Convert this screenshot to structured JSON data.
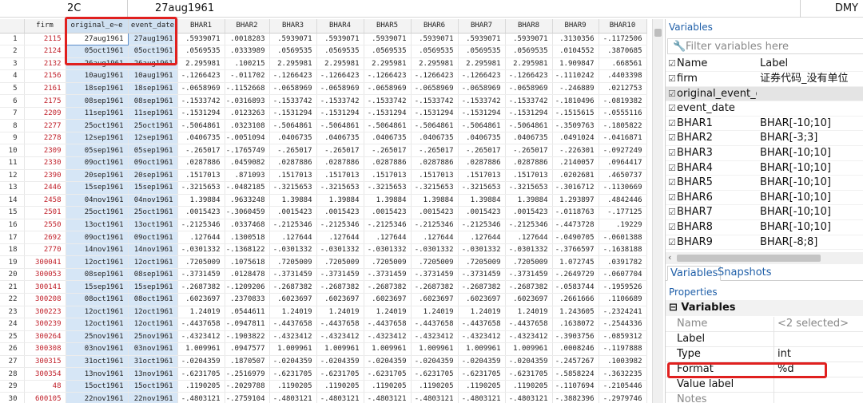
{
  "topbar": {
    "cell_ref": "2C",
    "cell_value": "27aug1961",
    "format_hint": "DMY"
  },
  "grid": {
    "columns": [
      "firm",
      "original_e~e",
      "event_date",
      "BHAR1",
      "BHAR2",
      "BHAR3",
      "BHAR4",
      "BHAR5",
      "BHAR6",
      "BHAR7",
      "BHAR8",
      "BHAR9",
      "BHAR10"
    ],
    "rows": [
      [
        "1",
        "2115",
        "27aug1961",
        "27aug1961",
        ".5939071",
        ".0018283",
        ".5939071",
        ".5939071",
        ".5939071",
        ".5939071",
        ".5939071",
        ".5939071",
        ".3130356",
        "-.1172506"
      ],
      [
        "2",
        "2124",
        "05oct1961",
        "05oct1961",
        ".0569535",
        ".0333989",
        ".0569535",
        ".0569535",
        ".0569535",
        ".0569535",
        ".0569535",
        ".0569535",
        ".0104552",
        ".3870685"
      ],
      [
        "3",
        "2132",
        "26aug1961",
        "26aug1961",
        "2.295981",
        ".100215",
        "2.295981",
        "2.295981",
        "2.295981",
        "2.295981",
        "2.295981",
        "2.295981",
        "1.909847",
        ".668561"
      ],
      [
        "4",
        "2156",
        "10aug1961",
        "10aug1961",
        "-.1266423",
        "-.011702",
        "-.1266423",
        "-.1266423",
        "-.1266423",
        "-.1266423",
        "-.1266423",
        "-.1266423",
        "-.1110242",
        ".4403398"
      ],
      [
        "5",
        "2161",
        "18sep1961",
        "18sep1961",
        "-.0658969",
        "-.1152668",
        "-.0658969",
        "-.0658969",
        "-.0658969",
        "-.0658969",
        "-.0658969",
        "-.0658969",
        "-.246889",
        ".0212753"
      ],
      [
        "6",
        "2175",
        "08sep1961",
        "08sep1961",
        "-.1533742",
        "-.0316893",
        "-.1533742",
        "-.1533742",
        "-.1533742",
        "-.1533742",
        "-.1533742",
        "-.1533742",
        "-.1810496",
        "-.0819382"
      ],
      [
        "7",
        "2209",
        "11sep1961",
        "11sep1961",
        "-.1531294",
        ".0123263",
        "-.1531294",
        "-.1531294",
        "-.1531294",
        "-.1531294",
        "-.1531294",
        "-.1531294",
        "-.1515615",
        "-.0555116"
      ],
      [
        "8",
        "2277",
        "25oct1961",
        "25oct1961",
        "-.5064861",
        ".0323108",
        "-.5064861",
        "-.5064861",
        "-.5064861",
        "-.5064861",
        "-.5064861",
        "-.5064861",
        "-.3509763",
        "-.1805822"
      ],
      [
        "9",
        "2278",
        "12sep1961",
        "12sep1961",
        ".0406735",
        "-.0051094",
        ".0406735",
        ".0406735",
        ".0406735",
        ".0406735",
        ".0406735",
        ".0406735",
        ".0491024",
        "-.0416871"
      ],
      [
        "10",
        "2309",
        "05sep1961",
        "05sep1961",
        "-.265017",
        "-.1765749",
        "-.265017",
        "-.265017",
        "-.265017",
        "-.265017",
        "-.265017",
        "-.265017",
        "-.226301",
        "-.0927249"
      ],
      [
        "11",
        "2330",
        "09oct1961",
        "09oct1961",
        ".0287886",
        ".0459082",
        ".0287886",
        ".0287886",
        ".0287886",
        ".0287886",
        ".0287886",
        ".0287886",
        ".2140057",
        ".0964417"
      ],
      [
        "12",
        "2390",
        "20sep1961",
        "20sep1961",
        ".1517013",
        ".871093",
        ".1517013",
        ".1517013",
        ".1517013",
        ".1517013",
        ".1517013",
        ".1517013",
        ".0202681",
        ".4650737"
      ],
      [
        "13",
        "2446",
        "15sep1961",
        "15sep1961",
        "-.3215653",
        "-.0482185",
        "-.3215653",
        "-.3215653",
        "-.3215653",
        "-.3215653",
        "-.3215653",
        "-.3215653",
        "-.3016712",
        "-.1130669"
      ],
      [
        "14",
        "2458",
        "04nov1961",
        "04nov1961",
        "1.39884",
        ".9633248",
        "1.39884",
        "1.39884",
        "1.39884",
        "1.39884",
        "1.39884",
        "1.39884",
        "1.293897",
        ".4842446"
      ],
      [
        "15",
        "2501",
        "25oct1961",
        "25oct1961",
        ".0015423",
        "-.3060459",
        ".0015423",
        ".0015423",
        ".0015423",
        ".0015423",
        ".0015423",
        ".0015423",
        "-.0118763",
        "-.177125"
      ],
      [
        "16",
        "2550",
        "13oct1961",
        "13oct1961",
        "-.2125346",
        ".0337468",
        "-.2125346",
        "-.2125346",
        "-.2125346",
        "-.2125346",
        "-.2125346",
        "-.2125346",
        "-.4473728",
        ".19229"
      ],
      [
        "17",
        "2692",
        "09oct1961",
        "09oct1961",
        ".127644",
        ".1300518",
        ".127644",
        ".127644",
        ".127644",
        ".127644",
        ".127644",
        ".127644",
        "-.0490705",
        "-.0601388"
      ],
      [
        "18",
        "2770",
        "14nov1961",
        "14nov1961",
        "-.0301332",
        "-.1368122",
        "-.0301332",
        "-.0301332",
        "-.0301332",
        "-.0301332",
        "-.0301332",
        "-.0301332",
        "-.3766597",
        "-.1638188"
      ],
      [
        "19",
        "300041",
        "12oct1961",
        "12oct1961",
        ".7205009",
        ".1075618",
        ".7205009",
        ".7205009",
        ".7205009",
        ".7205009",
        ".7205009",
        ".7205009",
        "1.072745",
        ".0391782"
      ],
      [
        "20",
        "300053",
        "08sep1961",
        "08sep1961",
        "-.3731459",
        ".0128478",
        "-.3731459",
        "-.3731459",
        "-.3731459",
        "-.3731459",
        "-.3731459",
        "-.3731459",
        "-.2649729",
        "-.0607704"
      ],
      [
        "21",
        "300141",
        "15sep1961",
        "15sep1961",
        "-.2687382",
        "-.1209206",
        "-.2687382",
        "-.2687382",
        "-.2687382",
        "-.2687382",
        "-.2687382",
        "-.2687382",
        "-.0583744",
        "-.1959526"
      ],
      [
        "22",
        "300208",
        "08oct1961",
        "08oct1961",
        ".6023697",
        ".2370833",
        ".6023697",
        ".6023697",
        ".6023697",
        ".6023697",
        ".6023697",
        ".6023697",
        ".2661666",
        ".1106689"
      ],
      [
        "23",
        "300223",
        "12oct1961",
        "12oct1961",
        "1.24019",
        ".0544611",
        "1.24019",
        "1.24019",
        "1.24019",
        "1.24019",
        "1.24019",
        "1.24019",
        "1.243605",
        "-.2324241"
      ],
      [
        "24",
        "300239",
        "12oct1961",
        "12oct1961",
        "-.4437658",
        "-.0947811",
        "-.4437658",
        "-.4437658",
        "-.4437658",
        "-.4437658",
        "-.4437658",
        "-.4437658",
        ".1638072",
        "-.2544336"
      ],
      [
        "25",
        "300264",
        "25nov1961",
        "25nov1961",
        "-.4323412",
        "-.1903822",
        "-.4323412",
        "-.4323412",
        "-.4323412",
        "-.4323412",
        "-.4323412",
        "-.4323412",
        "-.3903756",
        "-.0859312"
      ],
      [
        "26",
        "300308",
        "03nov1961",
        "03nov1961",
        "1.009961",
        ".0947577",
        "1.009961",
        "1.009961",
        "1.009961",
        "1.009961",
        "1.009961",
        "1.009961",
        ".0008246",
        "-.1197888"
      ],
      [
        "27",
        "300315",
        "31oct1961",
        "31oct1961",
        "-.0204359",
        ".1870507",
        "-.0204359",
        "-.0204359",
        "-.0204359",
        "-.0204359",
        "-.0204359",
        "-.0204359",
        "-.2457267",
        ".1003982"
      ],
      [
        "28",
        "300354",
        "13nov1961",
        "13nov1961",
        "-.6231705",
        "-.2516979",
        "-.6231705",
        "-.6231705",
        "-.6231705",
        "-.6231705",
        "-.6231705",
        "-.6231705",
        "-.5858224",
        "-.3632235"
      ],
      [
        "29",
        "48",
        "15oct1961",
        "15oct1961",
        ".1190205",
        "-.2029788",
        ".1190205",
        ".1190205",
        ".1190205",
        ".1190205",
        ".1190205",
        ".1190205",
        "-.1107694",
        "-.2105446"
      ],
      [
        "30",
        "600105",
        "22nov1961",
        "22nov1961",
        "-.4803121",
        "-.2759104",
        "-.4803121",
        "-.4803121",
        "-.4803121",
        "-.4803121",
        "-.4803121",
        "-.4803121",
        "-.3882396",
        "-.2979746"
      ],
      [
        "31",
        "600193",
        "21jul1961",
        "21jul1961",
        "1.25924",
        "2.182956",
        "1.25924",
        "1.25924",
        "1.25924",
        "1.25924",
        "1.25924",
        "1.25924",
        ".6277844",
        ".579879"
      ]
    ]
  },
  "variables_panel": {
    "title": "Variables",
    "filter_placeholder": "Filter variables here",
    "header": {
      "name": "Name",
      "label": "Label"
    },
    "items": [
      {
        "name": "firm",
        "label": "证券代码_没有单位"
      },
      {
        "name": "original_event_d...",
        "label": ""
      },
      {
        "name": "event_date",
        "label": ""
      },
      {
        "name": "BHAR1",
        "label": "BHAR[-10;10]"
      },
      {
        "name": "BHAR2",
        "label": "BHAR[-3;3]"
      },
      {
        "name": "BHAR3",
        "label": "BHAR[-10;10]"
      },
      {
        "name": "BHAR4",
        "label": "BHAR[-10;10]"
      },
      {
        "name": "BHAR5",
        "label": "BHAR[-10;10]"
      },
      {
        "name": "BHAR6",
        "label": "BHAR[-10;10]"
      },
      {
        "name": "BHAR7",
        "label": "BHAR[-10;10]"
      },
      {
        "name": "BHAR8",
        "label": "BHAR[-10;10]"
      },
      {
        "name": "BHAR9",
        "label": "BHAR[-8;8]"
      }
    ],
    "tabs": [
      "Variables",
      "Snapshots"
    ]
  },
  "properties_panel": {
    "title": "Properties",
    "section": "Variables",
    "rows": [
      {
        "key": "Name",
        "value": "<2 selected>"
      },
      {
        "key": "Label",
        "value": ""
      },
      {
        "key": "Type",
        "value": "int"
      },
      {
        "key": "Format",
        "value": "%d"
      },
      {
        "key": "Value label",
        "value": ""
      },
      {
        "key": "Notes",
        "value": ""
      }
    ]
  },
  "colors": {
    "accent": "#1f5fa8",
    "highlight_box": "#e0201f",
    "selected_column": "#d6e6f6",
    "firm_text": "#c0202a"
  }
}
